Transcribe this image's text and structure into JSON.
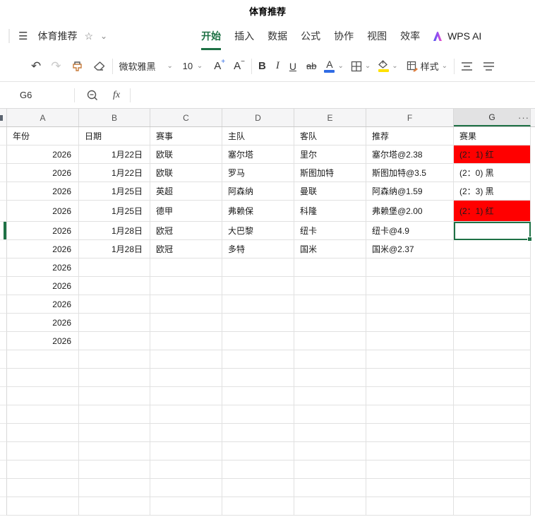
{
  "window": {
    "title": "体育推荐"
  },
  "icons": {
    "hamburger": "☰",
    "star": "☆",
    "chevron_down": "⌄",
    "undo": "↶",
    "redo": "↷"
  },
  "menu_bar": {
    "doc_title": "体育推荐",
    "tabs": [
      "开始",
      "插入",
      "数据",
      "公式",
      "协作",
      "视图",
      "效率"
    ],
    "active_tab": "开始",
    "ai_label": "WPS AI"
  },
  "toolbar": {
    "font_name": "微软雅黑",
    "font_size": "10",
    "grow_letter": "A",
    "grow_sign": "+",
    "shrink_letter": "A",
    "shrink_sign": "−",
    "bold": "B",
    "italic": "I",
    "underline": "U",
    "strikethrough": "ab",
    "font_color_letter": "A",
    "style_label": "样式"
  },
  "formula_bar": {
    "cell_ref": "G6",
    "fx_label": "fx",
    "formula": ""
  },
  "sheet": {
    "columns": [
      "A",
      "B",
      "C",
      "D",
      "E",
      "F",
      "G"
    ],
    "selected_column": "G",
    "selected_cell": "G6",
    "more_cols": "···",
    "colors": {
      "accent_green": "#1e7145",
      "result_red": "#ff0000"
    },
    "rows": [
      {
        "header": true,
        "cells": [
          "年份",
          "日期",
          "赛事",
          "主队",
          "客队",
          "推荐",
          "赛果"
        ]
      },
      {
        "g_red": true,
        "cells": [
          "2026",
          "1月22日",
          "欧联",
          "塞尔塔",
          "里尔",
          "塞尔塔@2.38",
          "(2：1) 红"
        ]
      },
      {
        "cells": [
          "2026",
          "1月22日",
          "欧联",
          "罗马",
          "斯图加特",
          "斯图加特@3.5",
          "(2：0) 黑"
        ]
      },
      {
        "cells": [
          "2026",
          "1月25日",
          "英超",
          "阿森纳",
          "曼联",
          "阿森纳@1.59",
          "(2：3) 黑"
        ]
      },
      {
        "g_red": true,
        "tall": true,
        "cells": [
          "2026",
          "1月25日",
          "德甲",
          "弗赖保",
          "科隆",
          "弗赖堡@2.00",
          "(2：1) 红"
        ]
      },
      {
        "selected_row": true,
        "cells": [
          "2026",
          "1月28日",
          "欧冠",
          "大巴黎",
          "纽卡",
          "纽卡@4.9",
          ""
        ]
      },
      {
        "cells": [
          "2026",
          "1月28日",
          "欧冠",
          "多特",
          "国米",
          "国米@2.37",
          ""
        ]
      },
      {
        "cells": [
          "2026",
          "",
          "",
          "",
          "",
          "",
          ""
        ]
      },
      {
        "cells": [
          "2026",
          "",
          "",
          "",
          "",
          "",
          ""
        ]
      },
      {
        "cells": [
          "2026",
          "",
          "",
          "",
          "",
          "",
          ""
        ]
      },
      {
        "cells": [
          "2026",
          "",
          "",
          "",
          "",
          "",
          ""
        ]
      },
      {
        "cells": [
          "2026",
          "",
          "",
          "",
          "",
          "",
          ""
        ]
      }
    ]
  }
}
